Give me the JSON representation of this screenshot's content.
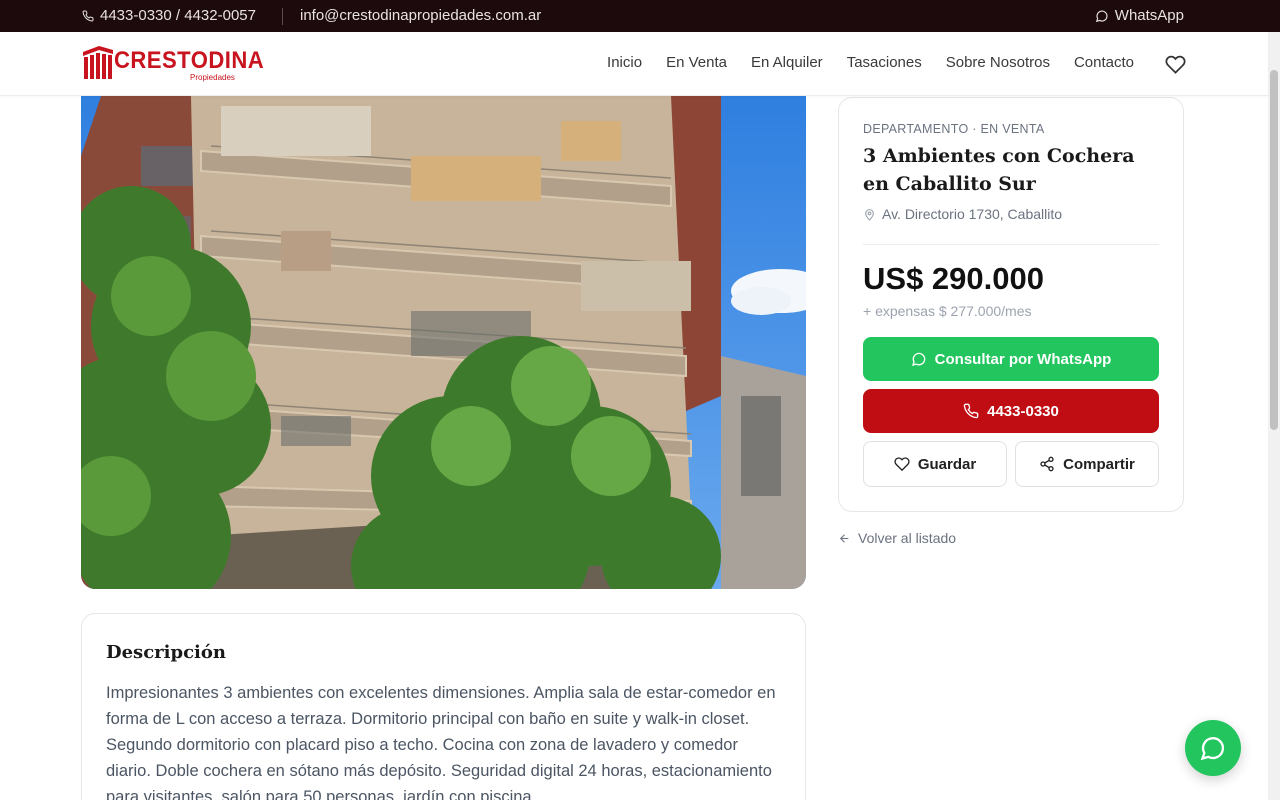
{
  "topbar": {
    "phone": "4433-0330 / 4432-0057",
    "email": "info@crestodinapropiedades.com.ar",
    "whatsapp_label": "WhatsApp"
  },
  "header": {
    "logo_text": "CRESTODINA",
    "logo_sub": "Propiedades",
    "nav": [
      "Inicio",
      "En Venta",
      "En Alquiler",
      "Tasaciones",
      "Sobre Nosotros",
      "Contacto"
    ]
  },
  "listing": {
    "kicker": "DEPARTAMENTO · EN VENTA",
    "title": "3 Ambientes con Cochera en Caballito Sur",
    "address": "Av. Directorio 1730, Caballito",
    "price": "US$ 290.000",
    "expenses": "+ expensas $ 277.000/mes",
    "whatsapp_button": "Consultar por WhatsApp",
    "call_button": "4433-0330",
    "save_button": "Guardar",
    "share_button": "Compartir"
  },
  "back_link": "Volver al listado",
  "description": {
    "heading": "Descripción",
    "text": "Impresionantes 3 ambientes con excelentes dimensiones. Amplia sala de estar-comedor en forma de L con acceso a terraza. Dormitorio principal con baño en suite y walk-in closet. Segundo dormitorio con placard piso a techo. Cocina con zona de lavadero y comedor diario. Doble cochera en sótano más depósito. Seguridad digital 24 horas, estacionamiento para visitantes, salón para 50 personas, jardín con piscina."
  },
  "colors": {
    "brand_red": "#c8141e",
    "call_red": "#c00d13",
    "whatsapp_green": "#22c55e",
    "topbar_bg": "#1c0a0c"
  }
}
